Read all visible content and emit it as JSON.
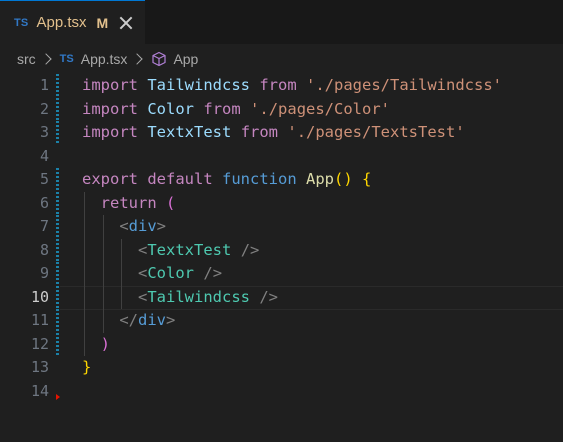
{
  "tab": {
    "badge": "TS",
    "title": "App.tsx",
    "status": "M"
  },
  "breadcrumb": {
    "folder": "src",
    "file_badge": "TS",
    "file": "App.tsx",
    "symbol": "App"
  },
  "editor": {
    "active_line": 10,
    "line_numbers": [
      "1",
      "2",
      "3",
      "4",
      "5",
      "6",
      "7",
      "8",
      "9",
      "10",
      "11",
      "12",
      "13",
      "14"
    ],
    "lines": [
      [
        {
          "t": "import",
          "c": "kw"
        },
        {
          "t": " ",
          "c": "plain"
        },
        {
          "t": "Tailwindcss",
          "c": "id"
        },
        {
          "t": " ",
          "c": "plain"
        },
        {
          "t": "from",
          "c": "kw"
        },
        {
          "t": " ",
          "c": "plain"
        },
        {
          "t": "'./pages/Tailwindcss'",
          "c": "str"
        }
      ],
      [
        {
          "t": "import",
          "c": "kw"
        },
        {
          "t": " ",
          "c": "plain"
        },
        {
          "t": "Color",
          "c": "id"
        },
        {
          "t": " ",
          "c": "plain"
        },
        {
          "t": "from",
          "c": "kw"
        },
        {
          "t": " ",
          "c": "plain"
        },
        {
          "t": "'./pages/Color'",
          "c": "str"
        }
      ],
      [
        {
          "t": "import",
          "c": "kw"
        },
        {
          "t": " ",
          "c": "plain"
        },
        {
          "t": "TextxTest",
          "c": "id"
        },
        {
          "t": " ",
          "c": "plain"
        },
        {
          "t": "from",
          "c": "kw"
        },
        {
          "t": " ",
          "c": "plain"
        },
        {
          "t": "'./pages/TextsTest'",
          "c": "str"
        }
      ],
      [],
      [
        {
          "t": "export",
          "c": "kw"
        },
        {
          "t": " ",
          "c": "plain"
        },
        {
          "t": "default",
          "c": "kw"
        },
        {
          "t": " ",
          "c": "plain"
        },
        {
          "t": "function",
          "c": "kw2"
        },
        {
          "t": " ",
          "c": "plain"
        },
        {
          "t": "App",
          "c": "fn"
        },
        {
          "t": "()",
          "c": "b1"
        },
        {
          "t": " ",
          "c": "plain"
        },
        {
          "t": "{",
          "c": "b1"
        }
      ],
      [
        {
          "t": "  ",
          "c": "plain"
        },
        {
          "t": "return",
          "c": "kw"
        },
        {
          "t": " ",
          "c": "plain"
        },
        {
          "t": "(",
          "c": "b2"
        }
      ],
      [
        {
          "t": "    ",
          "c": "plain"
        },
        {
          "t": "<",
          "c": "ang"
        },
        {
          "t": "div",
          "c": "tagk"
        },
        {
          "t": ">",
          "c": "ang"
        }
      ],
      [
        {
          "t": "      ",
          "c": "plain"
        },
        {
          "t": "<",
          "c": "ang"
        },
        {
          "t": "TextxTest",
          "c": "tag"
        },
        {
          "t": " ",
          "c": "plain"
        },
        {
          "t": "/>",
          "c": "ang"
        }
      ],
      [
        {
          "t": "      ",
          "c": "plain"
        },
        {
          "t": "<",
          "c": "ang"
        },
        {
          "t": "Color",
          "c": "tag"
        },
        {
          "t": " ",
          "c": "plain"
        },
        {
          "t": "/>",
          "c": "ang"
        }
      ],
      [
        {
          "t": "      ",
          "c": "plain"
        },
        {
          "t": "<",
          "c": "ang"
        },
        {
          "t": "Tailwindcss",
          "c": "tag"
        },
        {
          "t": " ",
          "c": "plain"
        },
        {
          "t": "/>",
          "c": "ang"
        }
      ],
      [
        {
          "t": "    ",
          "c": "plain"
        },
        {
          "t": "</",
          "c": "ang"
        },
        {
          "t": "div",
          "c": "tagk"
        },
        {
          "t": ">",
          "c": "ang"
        }
      ],
      [
        {
          "t": "  ",
          "c": "plain"
        },
        {
          "t": ")",
          "c": "b2"
        }
      ],
      [
        {
          "t": "}",
          "c": "b1"
        }
      ],
      []
    ],
    "modified_lines": [
      1,
      2,
      3,
      5,
      6,
      7,
      8,
      9,
      10,
      11,
      12
    ],
    "deleted_after_line": 14
  },
  "colors": {
    "accent": "#0078d4",
    "ts_badge": "#3178c6",
    "modified_tab": "#e2c08d",
    "gutter_modified": "#1b81a8",
    "gutter_deleted": "#e51400"
  }
}
